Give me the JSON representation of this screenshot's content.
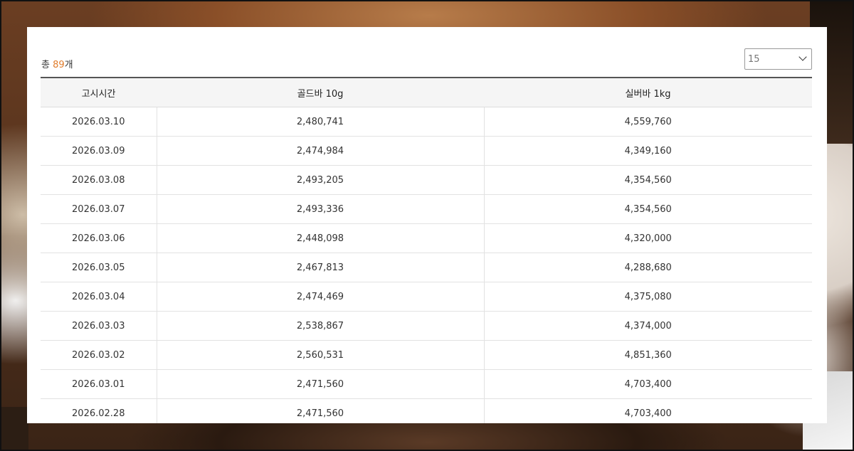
{
  "summary": {
    "prefix": "총 ",
    "count": "89",
    "suffix": "개"
  },
  "page_size": {
    "selected": "15"
  },
  "table": {
    "headers": [
      "고시시간",
      "골드바 10g",
      "실버바 1kg"
    ],
    "rows": [
      [
        "2026.03.10",
        "2,480,741",
        "4,559,760"
      ],
      [
        "2026.03.09",
        "2,474,984",
        "4,349,160"
      ],
      [
        "2026.03.08",
        "2,493,205",
        "4,354,560"
      ],
      [
        "2026.03.07",
        "2,493,336",
        "4,354,560"
      ],
      [
        "2026.03.06",
        "2,448,098",
        "4,320,000"
      ],
      [
        "2026.03.05",
        "2,467,813",
        "4,288,680"
      ],
      [
        "2026.03.04",
        "2,474,469",
        "4,375,080"
      ],
      [
        "2026.03.03",
        "2,538,867",
        "4,374,000"
      ],
      [
        "2026.03.02",
        "2,560,531",
        "4,851,360"
      ],
      [
        "2026.03.01",
        "2,471,560",
        "4,703,400"
      ],
      [
        "2026.02.28",
        "2,471,560",
        "4,703,400"
      ]
    ]
  },
  "colors": {
    "accent": "#e07c2b",
    "header_bg": "#f5f5f5"
  }
}
